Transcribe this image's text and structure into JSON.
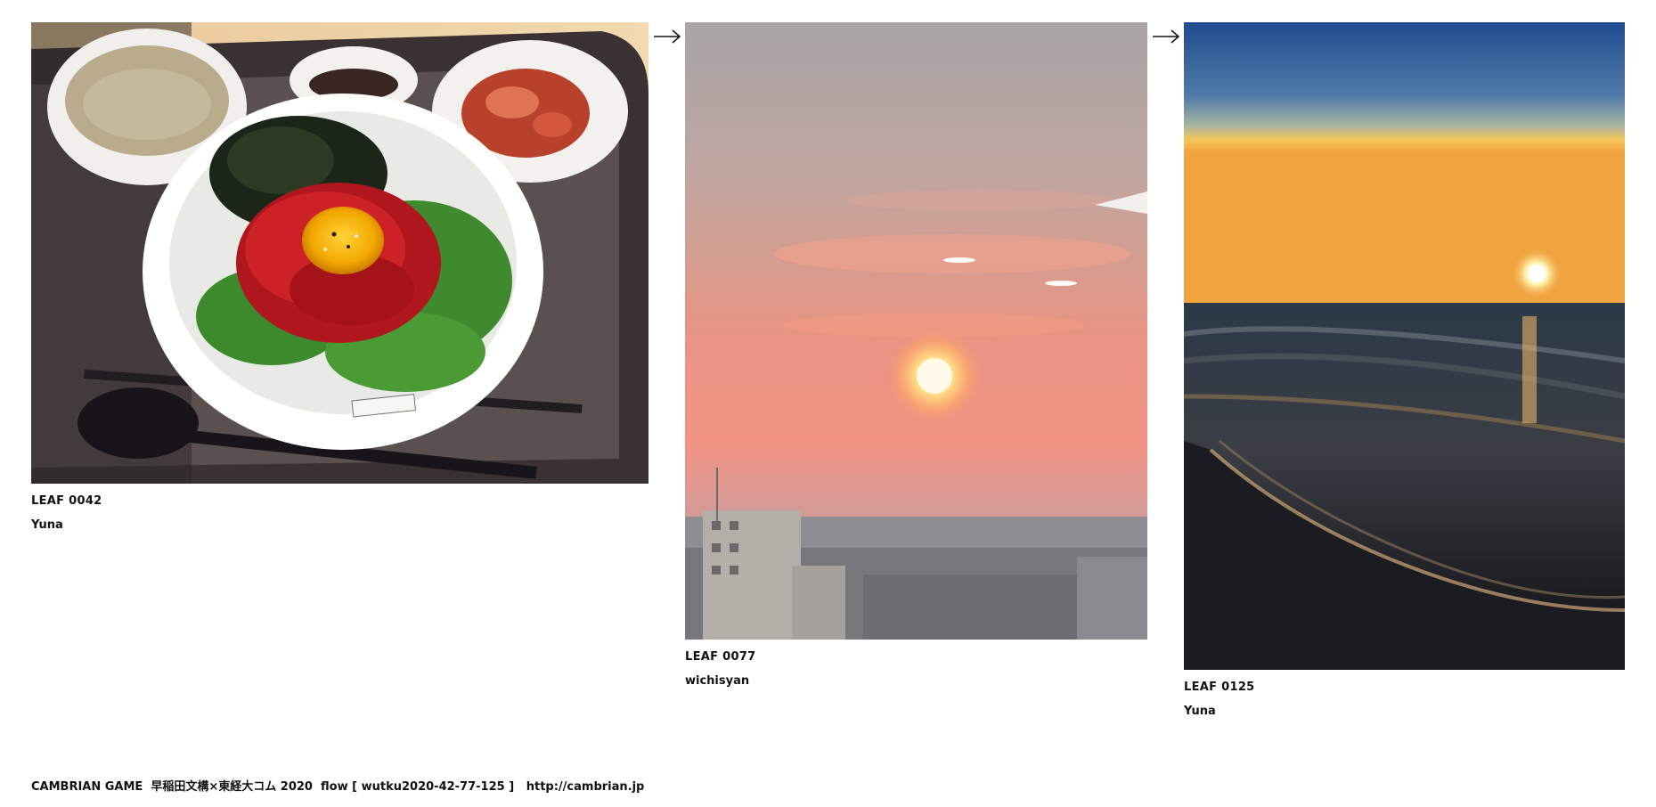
{
  "leaves": [
    {
      "id": "LEAF 0042",
      "author": "Yuna",
      "photo_subject": "yukhoe-bowl-photo"
    },
    {
      "id": "LEAF 0077",
      "author": "wichisyan",
      "photo_subject": "city-sunset-photo"
    },
    {
      "id": "LEAF 0125",
      "author": "Yuna",
      "photo_subject": "beach-sunset-photo"
    }
  ],
  "arrows": [
    "right-arrow-icon",
    "right-arrow-icon"
  ],
  "footer": {
    "game": "CAMBRIAN GAME",
    "event": "早稲田文構×東経大コム 2020",
    "flow_label": "flow [ wutku2020-42-77-125 ]",
    "url": "http://cambrian.jp"
  },
  "colors": {
    "background": "#ffffff",
    "text": "#111111"
  }
}
